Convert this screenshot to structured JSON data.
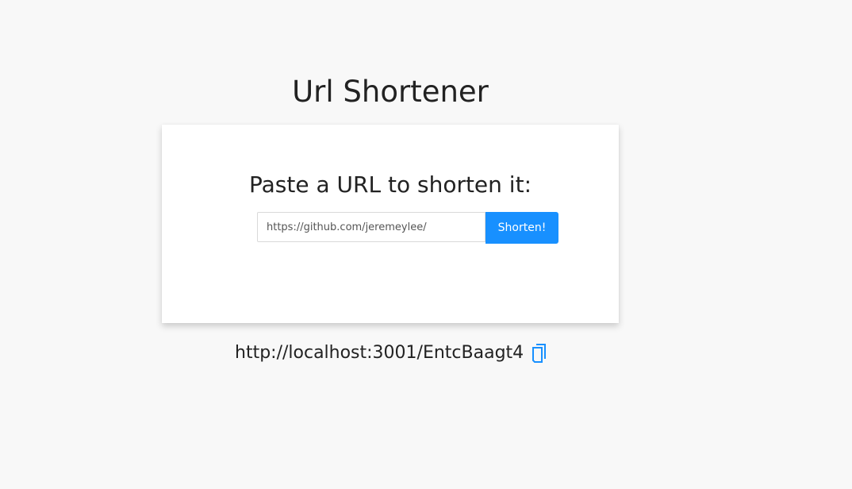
{
  "page": {
    "title": "Url Shortener"
  },
  "card": {
    "heading": "Paste a URL to shorten it:",
    "input": {
      "value": "",
      "placeholder": "https://github.com/jeremeylee/"
    },
    "submit_label": "Shorten!"
  },
  "result": {
    "short_url": "http://localhost:3001/EntcBaagt4",
    "copy_icon": "copy-icon"
  },
  "colors": {
    "background": "#f8f8f8",
    "card": "#ffffff",
    "accent": "#1890ff",
    "text": "#222222"
  }
}
